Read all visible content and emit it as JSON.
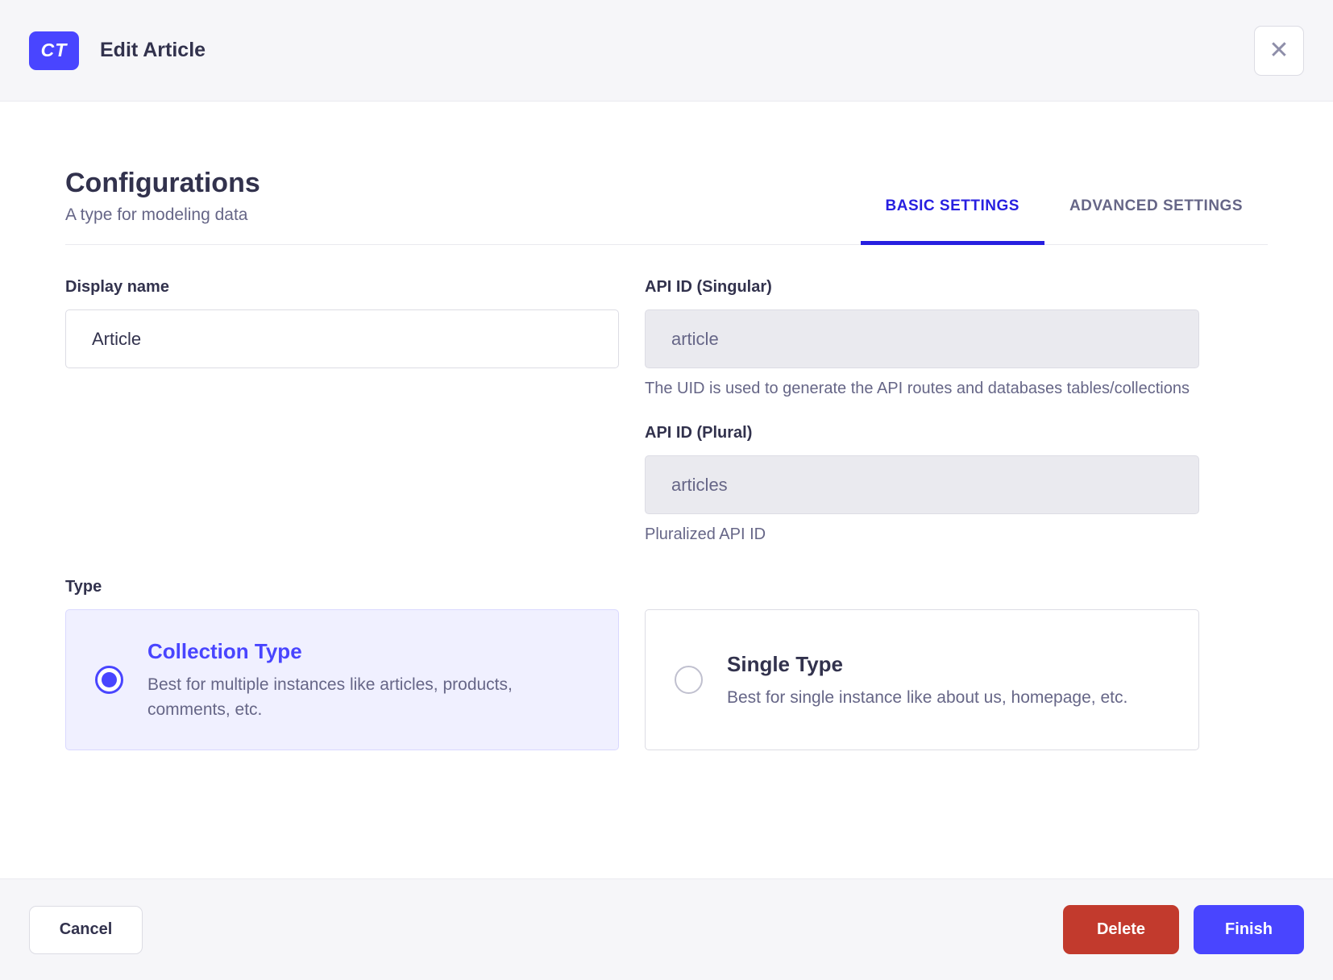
{
  "header": {
    "badge_label": "CT",
    "title": "Edit Article",
    "close_glyph": "✕"
  },
  "section": {
    "title": "Configurations",
    "subtitle": "A type for modeling data"
  },
  "tabs": [
    {
      "label": "BASIC SETTINGS",
      "active": true
    },
    {
      "label": "ADVANCED SETTINGS",
      "active": false
    }
  ],
  "fields": {
    "display_name": {
      "label": "Display name",
      "value": "Article"
    },
    "api_id_singular": {
      "label": "API ID (Singular)",
      "value": "article",
      "hint": "The UID is used to generate the API routes and databases tables/collections"
    },
    "api_id_plural": {
      "label": "API ID (Plural)",
      "value": "articles",
      "hint": "Pluralized API ID"
    }
  },
  "type_section": {
    "label": "Type",
    "options": [
      {
        "title": "Collection Type",
        "description": "Best for multiple instances like articles, products, comments, etc.",
        "selected": true
      },
      {
        "title": "Single Type",
        "description": "Best for single instance like about us, homepage, etc.",
        "selected": false
      }
    ]
  },
  "footer": {
    "cancel_label": "Cancel",
    "delete_label": "Delete",
    "finish_label": "Finish"
  },
  "colors": {
    "primary": "#4945ff",
    "tab_active": "#271fe0",
    "danger": "#c23a2d",
    "surface_gray": "#f6f6f9",
    "border_light": "#eaeaef",
    "border_mid": "#dcdce4",
    "text_dark": "#32324d",
    "text_muted": "#666687",
    "card_selected_bg": "#f0f0ff"
  }
}
